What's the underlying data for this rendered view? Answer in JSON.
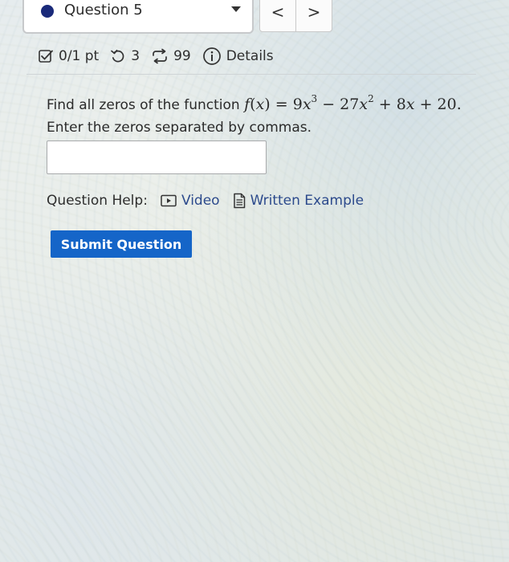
{
  "question_nav": {
    "label": "Question 5",
    "prev_label": "<",
    "next_label": ">",
    "indicator_color": "#1a2a7a"
  },
  "meta": {
    "score": "0/1 pt",
    "attempts": "3",
    "retries": "99",
    "details_label": "Details"
  },
  "question": {
    "prompt_prefix": "Find all zeros of the function",
    "math": {
      "f": "f",
      "x": "x",
      "open": "(",
      "close": ")",
      "eq": " = ",
      "c1": "9",
      "exp3": "3",
      "minus": " − ",
      "c2": "27",
      "exp2": "2",
      "plus1": " + ",
      "c3": "8",
      "plus2": " + ",
      "c4": "20",
      "end": "."
    },
    "instruction": "Enter the zeros separated by commas.",
    "answer_value": ""
  },
  "help": {
    "label": "Question Help:",
    "video_label": "Video",
    "written_label": "Written Example"
  },
  "submit_label": "Submit Question",
  "colors": {
    "accent": "#1565c8",
    "link": "#2c4a8c"
  }
}
